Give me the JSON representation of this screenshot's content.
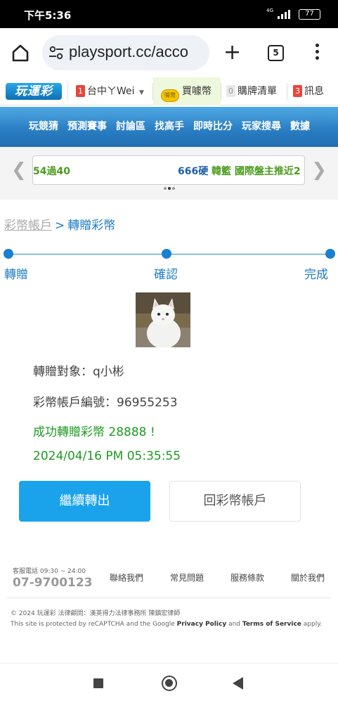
{
  "status_bar": {
    "time": "下午5:36",
    "network": "4G",
    "battery": "77"
  },
  "browser": {
    "url": "playsport.cc/acco",
    "tab_count": "5"
  },
  "site_bar": {
    "logo": "玩運彩",
    "user": {
      "count": "1",
      "label": "台中ㄚWei"
    },
    "buy_coins": "買噱幣",
    "coin_icon_text": "噱幣",
    "cart": {
      "count": "0",
      "label": "購牌清單"
    },
    "messages": {
      "count": "3",
      "label": "訊息"
    }
  },
  "nav": [
    "玩競猜",
    "預測賽事",
    "討論區",
    "找高手",
    "即時比分",
    "玩家搜尋",
    "數據"
  ],
  "ticker": {
    "left": "54過40",
    "center_num": "666硬",
    "center_text": "韓籃 國際盤主推近2"
  },
  "breadcrumb": {
    "parent": "彩幣帳戶",
    "separator": ">",
    "current": "轉贈彩幣"
  },
  "steps": [
    "轉贈",
    "確認",
    "完成"
  ],
  "result": {
    "recipient_label": "轉贈對象：",
    "recipient": "q小彬",
    "account_label": "彩幣帳戶編號：",
    "account_no": "96955253",
    "success_message": "成功轉贈彩幣 28888 !",
    "datetime": "2024/04/16 PM 05:35:55"
  },
  "buttons": {
    "continue": "繼續轉出",
    "back_to_account": "回彩幣帳戶"
  },
  "footer": {
    "hotline_label": "客服電話 09:30 ~ 24:00",
    "hotline": "07-9700123",
    "links": [
      "聯絡我們",
      "常見問題",
      "服務條款",
      "關於我們"
    ],
    "copyright": "© 2024 玩運彩 法律顧問：漢英得力法律事務所 陳鎮宏律師",
    "recaptcha_prefix": "This site is protected by reCAPTCHA and the Google ",
    "privacy": "Privacy Policy",
    "and": " and ",
    "terms": "Terms of Service",
    "recaptcha_suffix": " apply."
  },
  "colors": {
    "accent": "#1aa3ea",
    "success": "#1f9a22",
    "nav": "#2b7fc4"
  }
}
